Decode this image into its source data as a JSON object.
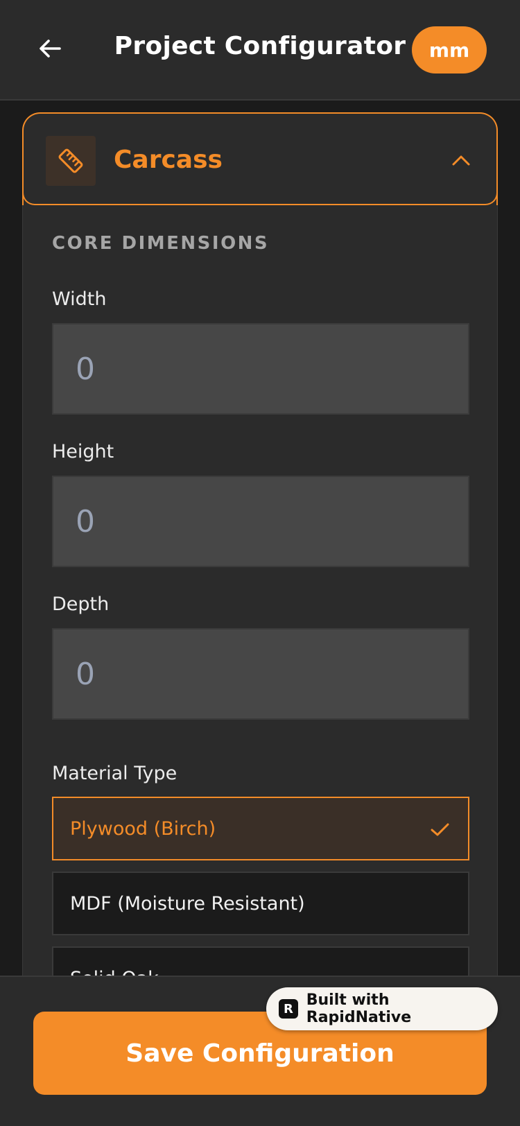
{
  "header": {
    "title": "Project Configurator",
    "unit_label": "mm"
  },
  "section": {
    "title": "Carcass",
    "icon": "ruler-icon",
    "expanded": true,
    "subsection_title": "CORE DIMENSIONS",
    "fields": [
      {
        "label": "Width",
        "placeholder": "0"
      },
      {
        "label": "Height",
        "placeholder": "0"
      },
      {
        "label": "Depth",
        "placeholder": "0"
      }
    ],
    "material": {
      "label": "Material Type",
      "options": [
        {
          "label": "Plywood (Birch)",
          "selected": true
        },
        {
          "label": "MDF (Moisture Resistant)",
          "selected": false
        },
        {
          "label": "Solid Oak",
          "selected": false
        }
      ]
    }
  },
  "footer": {
    "save_label": "Save Configuration"
  },
  "badge": {
    "label": "Built with RapidNative"
  },
  "colors": {
    "accent": "#f48c28",
    "background": "#1b1b1b",
    "surface": "#2b2b2b",
    "input": "#474747"
  }
}
